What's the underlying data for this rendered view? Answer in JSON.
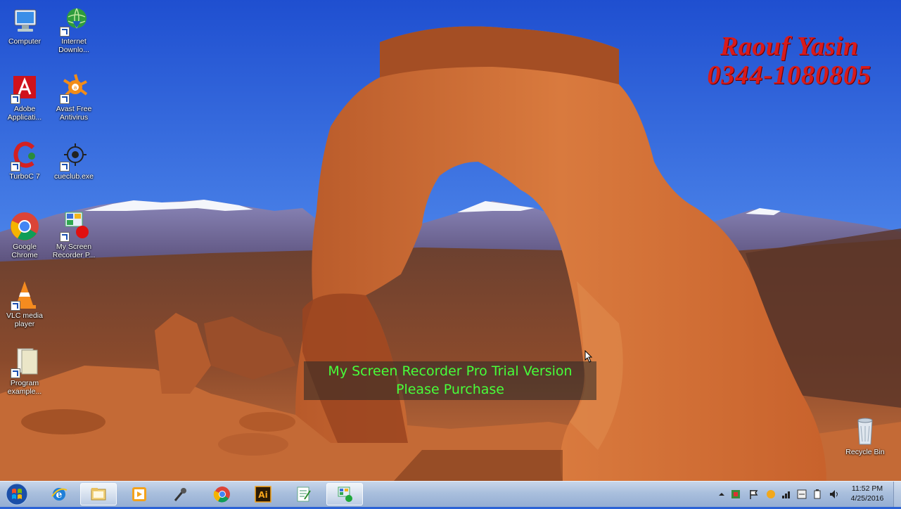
{
  "desktop": {
    "icons": [
      {
        "name": "computer",
        "label": "Computer"
      },
      {
        "name": "internet-download-manager",
        "label": "Internet Downlo..."
      },
      {
        "name": "adobe-application",
        "label": "Adobe Applicati..."
      },
      {
        "name": "avast-free-antivirus",
        "label": "Avast Free Antivirus"
      },
      {
        "name": "turbo-c",
        "label": "TurboC 7"
      },
      {
        "name": "cue-club",
        "label": "cueclub.exe"
      },
      {
        "name": "google-chrome",
        "label": "Google Chrome"
      },
      {
        "name": "my-screen-recorder",
        "label": "My Screen Recorder P..."
      },
      {
        "name": "vlc-media-player",
        "label": "VLC media player"
      },
      {
        "name": "program-examples",
        "label": "Program example..."
      },
      {
        "name": "recycle-bin",
        "label": "Recycle Bin"
      }
    ]
  },
  "watermark": {
    "name": "Raouf Yasin",
    "phone": "0344-1080805",
    "color": "#d81b1b"
  },
  "trial_banner": {
    "line1": "My Screen Recorder Pro Trial Version",
    "line2": "Please Purchase",
    "color": "#47ff3a"
  },
  "taskbar": {
    "pinned": [
      {
        "name": "internet-explorer",
        "icon": "ie-icon"
      },
      {
        "name": "windows-explorer",
        "icon": "folder-icon",
        "active": true
      },
      {
        "name": "media-player",
        "icon": "media-player-icon"
      },
      {
        "name": "microphone-app",
        "icon": "microphone-icon"
      },
      {
        "name": "google-chrome",
        "icon": "chrome-icon"
      },
      {
        "name": "adobe-illustrator",
        "icon": "illustrator-icon",
        "text": "Ai"
      },
      {
        "name": "notepad-app",
        "icon": "notepad-icon"
      },
      {
        "name": "my-screen-recorder",
        "icon": "screen-recorder-icon",
        "active": true
      }
    ],
    "clock": {
      "time": "11:52 PM",
      "date": "4/25/2016"
    }
  }
}
